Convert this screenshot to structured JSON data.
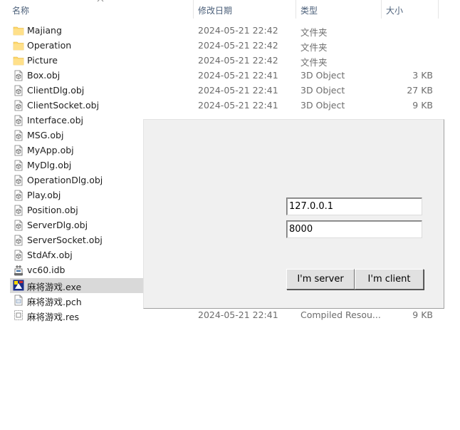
{
  "header": {
    "name_label": "名称",
    "date_label": "修改日期",
    "type_label": "类型",
    "size_label": "大小"
  },
  "files": [
    {
      "name": "Majiang",
      "date": "2024-05-21 22:42",
      "type": "文件夹",
      "size": "",
      "icon": "folder-icon"
    },
    {
      "name": "Operation",
      "date": "2024-05-21 22:42",
      "type": "文件夹",
      "size": "",
      "icon": "folder-icon"
    },
    {
      "name": "Picture",
      "date": "2024-05-21 22:42",
      "type": "文件夹",
      "size": "",
      "icon": "folder-icon"
    },
    {
      "name": "Box.obj",
      "date": "2024-05-21 22:41",
      "type": "3D Object",
      "size": "3 KB",
      "icon": "object-file-icon"
    },
    {
      "name": "ClientDlg.obj",
      "date": "2024-05-21 22:41",
      "type": "3D Object",
      "size": "27 KB",
      "icon": "object-file-icon"
    },
    {
      "name": "ClientSocket.obj",
      "date": "2024-05-21 22:41",
      "type": "3D Object",
      "size": "9 KB",
      "icon": "object-file-icon"
    },
    {
      "name": "Interface.obj",
      "date": "",
      "type": "",
      "size": "",
      "icon": "object-file-icon"
    },
    {
      "name": "MSG.obj",
      "date": "",
      "type": "",
      "size": "",
      "icon": "object-file-icon"
    },
    {
      "name": "MyApp.obj",
      "date": "",
      "type": "",
      "size": "",
      "icon": "object-file-icon"
    },
    {
      "name": "MyDlg.obj",
      "date": "",
      "type": "",
      "size": "",
      "icon": "object-file-icon"
    },
    {
      "name": "OperationDlg.obj",
      "date": "",
      "type": "",
      "size": "",
      "icon": "object-file-icon"
    },
    {
      "name": "Play.obj",
      "date": "",
      "type": "",
      "size": "",
      "icon": "object-file-icon"
    },
    {
      "name": "Position.obj",
      "date": "",
      "type": "",
      "size": "",
      "icon": "object-file-icon"
    },
    {
      "name": "ServerDlg.obj",
      "date": "",
      "type": "",
      "size": "",
      "icon": "object-file-icon"
    },
    {
      "name": "ServerSocket.obj",
      "date": "",
      "type": "",
      "size": "",
      "icon": "object-file-icon"
    },
    {
      "name": "StdAfx.obj",
      "date": "",
      "type": "",
      "size": "",
      "icon": "object-file-icon"
    },
    {
      "name": "vc60.idb",
      "date": "",
      "type": "",
      "size": "",
      "icon": "idb-file-icon"
    },
    {
      "name": "麻将游戏.exe",
      "date": "",
      "type": "",
      "size": "",
      "icon": "exe-app-icon",
      "selected": true
    },
    {
      "name": "麻将游戏.pch",
      "date": "",
      "type": "",
      "size": "",
      "icon": "generic-file-icon"
    },
    {
      "name": "麻将游戏.res",
      "date": "2024-05-21 22:41",
      "type": "Compiled Resou...",
      "size": "9 KB",
      "icon": "resource-file-icon"
    }
  ],
  "dialog": {
    "ip_value": "127.0.0.1",
    "port_value": "8000",
    "server_button": "I'm server",
    "client_button": "I'm client"
  },
  "colors": {
    "header_text": "#4c607a",
    "selection": "#d9d9d9",
    "dialog_bg": "#f0f0f0",
    "folder": "#ffd86b"
  }
}
